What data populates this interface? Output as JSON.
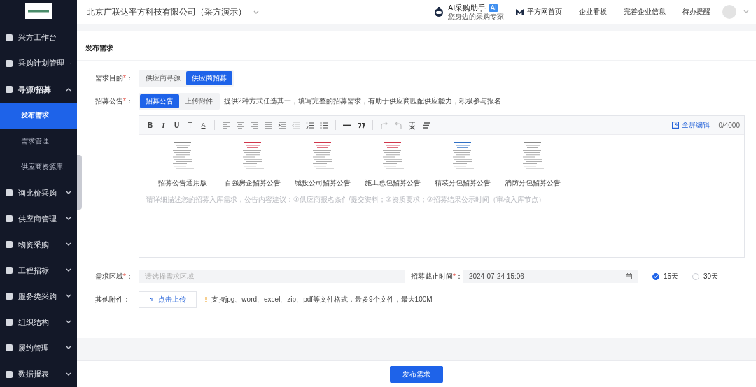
{
  "sidebar": {
    "items": [
      {
        "kind": "link",
        "label": "采方工作台"
      },
      {
        "kind": "group",
        "label": "采购计划管理",
        "expanded": false
      },
      {
        "kind": "group",
        "label": "寻源/招募",
        "expanded": true,
        "children": [
          {
            "label": "发布需求",
            "selected": true
          },
          {
            "label": "需求管理",
            "selected": false
          },
          {
            "label": "供应商资源库",
            "selected": false
          }
        ]
      },
      {
        "kind": "group",
        "label": "询比价采购",
        "expanded": false
      },
      {
        "kind": "group",
        "label": "供应商管理",
        "expanded": false
      },
      {
        "kind": "group",
        "label": "物资采购",
        "expanded": false
      },
      {
        "kind": "group",
        "label": "工程招标",
        "expanded": false
      },
      {
        "kind": "group",
        "label": "服务类采购",
        "expanded": false
      },
      {
        "kind": "group",
        "label": "组织结构",
        "expanded": false
      },
      {
        "kind": "group",
        "label": "履约管理",
        "expanded": false
      },
      {
        "kind": "group",
        "label": "数据报表",
        "expanded": false
      }
    ]
  },
  "header": {
    "company": "北京广联达平方科技有限公司（采方演示）",
    "assistant": {
      "title": "AI采购助手",
      "badge": "AI",
      "subtitle": "您身边的采购专家"
    },
    "links": [
      {
        "label": "平方网首页",
        "kind": "home"
      },
      {
        "label": "企业看板",
        "kind": "plain"
      },
      {
        "label": "完善企业信息",
        "kind": "plain"
      },
      {
        "label": "待办提醒",
        "kind": "plain"
      }
    ]
  },
  "form": {
    "title": "发布需求",
    "purpose": {
      "label": "需求目的",
      "mark": "*",
      "colon": "：",
      "options": [
        {
          "label": "供应商寻源",
          "selected": false
        },
        {
          "label": "供应商招募",
          "selected": true
        }
      ]
    },
    "notice": {
      "label": "招募公告",
      "mark": "*",
      "colon": "：",
      "tabs": [
        {
          "label": "招募公告",
          "selected": true
        },
        {
          "label": "上传附件",
          "selected": false
        }
      ],
      "hint": "提供2种方式任选其一，填写完整的招募需求，有助于供应商匹配供应能力，积极参与报名"
    },
    "editor": {
      "toolbar": [
        {
          "kind": "bold",
          "text": "B",
          "disabled": false
        },
        {
          "kind": "italic",
          "text": "I",
          "disabled": false
        },
        {
          "kind": "underline",
          "text": "U",
          "disabled": false
        },
        {
          "kind": "strike",
          "text": "T",
          "disabled": false
        },
        {
          "kind": "color",
          "text": "A",
          "disabled": false
        },
        {
          "kind": "sep"
        },
        {
          "kind": "align-left",
          "disabled": false
        },
        {
          "kind": "align-center",
          "disabled": false
        },
        {
          "kind": "align-right",
          "disabled": false
        },
        {
          "kind": "justify",
          "disabled": false
        },
        {
          "kind": "indent",
          "disabled": false
        },
        {
          "kind": "outdent",
          "disabled": true
        },
        {
          "kind": "ordered-list",
          "disabled": false
        },
        {
          "kind": "bullet-list",
          "disabled": false
        },
        {
          "kind": "sep"
        },
        {
          "kind": "rule",
          "disabled": false
        },
        {
          "kind": "quote",
          "disabled": false
        },
        {
          "kind": "sep"
        },
        {
          "kind": "redo",
          "disabled": true
        },
        {
          "kind": "undo",
          "disabled": true
        },
        {
          "kind": "clear",
          "disabled": false
        },
        {
          "kind": "format",
          "disabled": false
        }
      ],
      "fullscreen": "全屏编辑",
      "count": "0/4000",
      "templates": [
        {
          "name": "招募公告通用版"
        },
        {
          "name": "百强房企招募公告"
        },
        {
          "name": "城投公司招募公告"
        },
        {
          "name": "施工总包招募公告"
        },
        {
          "name": "精装分包招募公告"
        },
        {
          "name": "消防分包招募公告"
        }
      ],
      "placeholder": "请详细描述您的招募入库需求，公告内容建议：①供应商报名条件/提交资料；②资质要求；③招募结果公示时间（审核入库节点）"
    },
    "region": {
      "label": "需求区域",
      "mark": "*",
      "colon": "：",
      "placeholder": "请选择需求区域"
    },
    "deadline": {
      "label": "招募截止时间",
      "mark": "*",
      "colon": "：",
      "value": "2024-07-24 15:06",
      "options": [
        {
          "label": "15天",
          "selected": true
        },
        {
          "label": "30天",
          "selected": false
        }
      ]
    },
    "attachment": {
      "label": "其他附件",
      "colon": "：",
      "button": "点击上传",
      "note": "支持jpg、word、excel、zip、pdf等文件格式，最多9个文件，最大100M"
    }
  },
  "footer": {
    "submit": "发布需求"
  }
}
